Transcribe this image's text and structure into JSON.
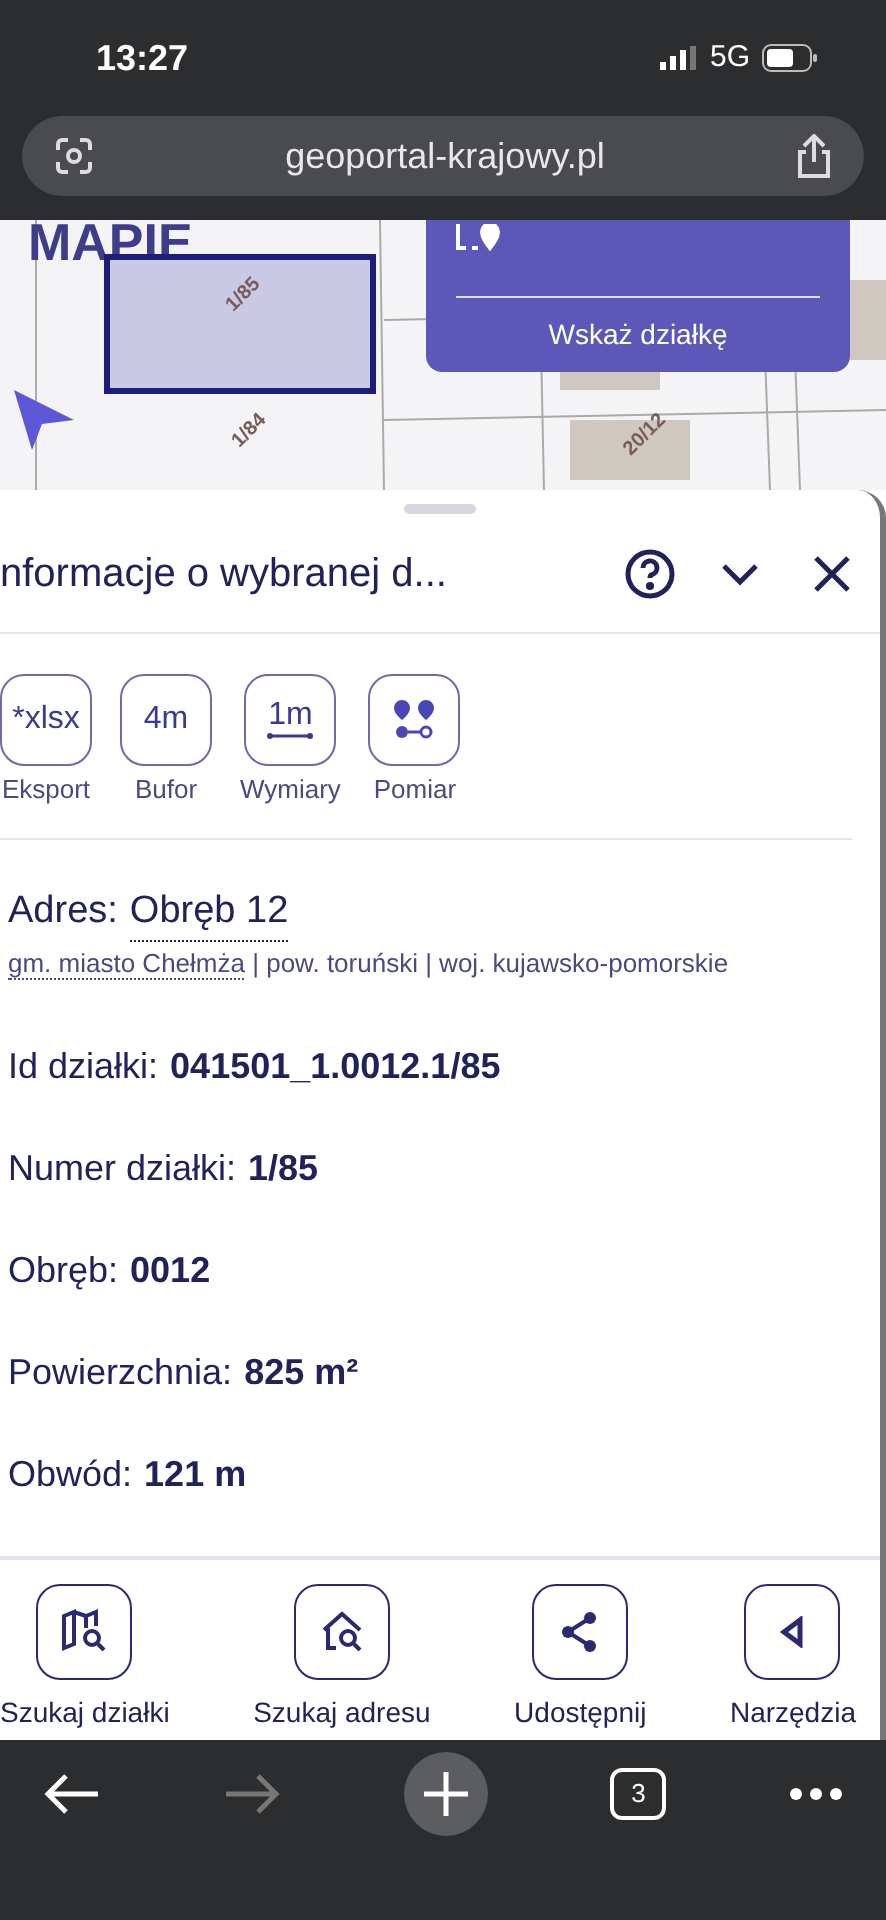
{
  "status_bar": {
    "time": "13:27",
    "network": "5G"
  },
  "browser": {
    "url": "geoportal-krajowy.pl",
    "tab_count": "3"
  },
  "map": {
    "heading": "MAPIE",
    "overlay_button": "Wskaż działkę",
    "parcels": [
      {
        "label": "1/85",
        "selected": true
      },
      {
        "label": "1/84",
        "selected": false
      },
      {
        "label": "20/12",
        "selected": false
      }
    ]
  },
  "panel": {
    "title": "nformacje o wybranej d...",
    "tools": [
      {
        "icon_text": "*xlsx",
        "label": "Eksport",
        "kind": "text"
      },
      {
        "icon_text": "4m",
        "label": "Bufor",
        "kind": "text"
      },
      {
        "icon_text": "1m",
        "label": "Wymiary",
        "kind": "ruler"
      },
      {
        "label": "Pomiar",
        "kind": "pins"
      }
    ],
    "address": {
      "label": "Adres:",
      "value": "Obręb 12",
      "link": "gm. miasto Chełmża",
      "rest": " | pow. toruński | woj. kujawsko-pomorskie"
    },
    "fields": [
      {
        "label": "Id działki:",
        "value": "041501_1.0012.1/85"
      },
      {
        "label": "Numer działki:",
        "value": "1/85"
      },
      {
        "label": "Obręb:",
        "value": "0012"
      },
      {
        "label": "Powierzchnia:",
        "value": "825 m²"
      },
      {
        "label": "Obwód:",
        "value": "121 m"
      }
    ]
  },
  "bottom_nav": [
    {
      "label": "Szukaj działki",
      "kind": "map-search"
    },
    {
      "label": "Szukaj adresu",
      "kind": "home-search"
    },
    {
      "label": "Udostępnij",
      "kind": "share"
    },
    {
      "label": "Narzędzia",
      "kind": "tools"
    }
  ]
}
